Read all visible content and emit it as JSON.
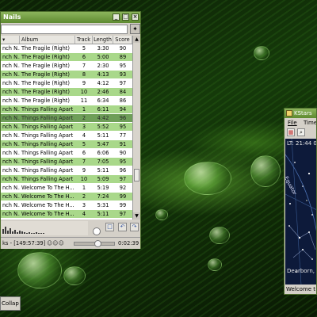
{
  "player": {
    "title": "Nails",
    "columns": [
      "",
      "Album",
      "Track",
      "Length",
      "Score"
    ],
    "rows": [
      {
        "artist": "nch N...",
        "album": "The Fragile (Right)",
        "track": "5",
        "length": "3:30",
        "score": "90"
      },
      {
        "artist": "nch N...",
        "album": "The Fragile (Right)",
        "track": "6",
        "length": "5:00",
        "score": "89"
      },
      {
        "artist": "nch N...",
        "album": "The Fragile (Right)",
        "track": "7",
        "length": "2:30",
        "score": "95"
      },
      {
        "artist": "nch N...",
        "album": "The Fragile (Right)",
        "track": "8",
        "length": "4:13",
        "score": "93"
      },
      {
        "artist": "nch N...",
        "album": "The Fragile (Right)",
        "track": "9",
        "length": "4:12",
        "score": "97"
      },
      {
        "artist": "nch N...",
        "album": "The Fragile (Right)",
        "track": "10",
        "length": "2:46",
        "score": "84"
      },
      {
        "artist": "nch N...",
        "album": "The Fragile (Right)",
        "track": "11",
        "length": "6:34",
        "score": "86"
      },
      {
        "artist": "nch N...",
        "album": "Things Falling Apart",
        "track": "1",
        "length": "6:11",
        "score": "94"
      },
      {
        "artist": "nch N...",
        "album": "Things Falling Apart",
        "track": "2",
        "length": "4:42",
        "score": "96",
        "playing": true
      },
      {
        "artist": "nch N...",
        "album": "Things Falling Apart",
        "track": "3",
        "length": "5:52",
        "score": "95"
      },
      {
        "artist": "nch N...",
        "album": "Things Falling Apart",
        "track": "4",
        "length": "5:11",
        "score": "77"
      },
      {
        "artist": "nch N...",
        "album": "Things Falling Apart",
        "track": "5",
        "length": "5:47",
        "score": "91"
      },
      {
        "artist": "nch N...",
        "album": "Things Falling Apart",
        "track": "6",
        "length": "6:06",
        "score": "90"
      },
      {
        "artist": "nch N...",
        "album": "Things Falling Apart",
        "track": "7",
        "length": "7:05",
        "score": "95"
      },
      {
        "artist": "nch N...",
        "album": "Things Falling Apart",
        "track": "9",
        "length": "5:11",
        "score": "96"
      },
      {
        "artist": "nch N...",
        "album": "Things Falling Apart",
        "track": "10",
        "length": "5:09",
        "score": "97"
      },
      {
        "artist": "nch N...",
        "album": "Welcome To The H...",
        "track": "1",
        "length": "5:19",
        "score": "92"
      },
      {
        "artist": "nch N...",
        "album": "Welcome To The H...",
        "track": "2",
        "length": "7:24",
        "score": "99"
      },
      {
        "artist": "nch N...",
        "album": "Welcome To The H...",
        "track": "3",
        "length": "5:31",
        "score": "99"
      },
      {
        "artist": "nch N...",
        "album": "Welcome To The H...",
        "track": "4",
        "length": "5:11",
        "score": "97"
      }
    ],
    "status_text": "ks - [149:57:39]",
    "time": "0:02:39",
    "progress_fraction": 0.55,
    "status_icons": "☺☺☺",
    "search_icon": "clear-icon",
    "controls": [
      "□",
      "↶",
      "↷"
    ]
  },
  "kstars": {
    "title": "KStars",
    "menu": [
      "File",
      "Time"
    ],
    "time_label": "LT: 21:44 0",
    "equator_label": "Equator",
    "location": "Dearborn,",
    "status": "Welcome t"
  },
  "taskbar": {
    "item_label": "Collap"
  }
}
